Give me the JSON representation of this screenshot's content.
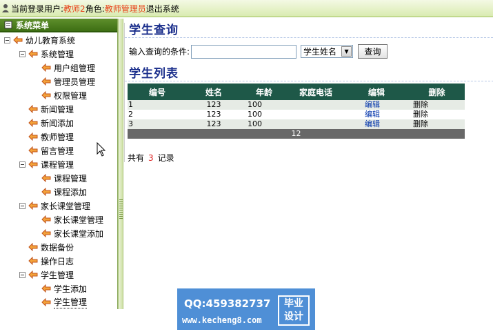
{
  "topbar": {
    "prefix": "当前登录用户:",
    "user": "教师2",
    "role_label": " 角色:",
    "role": "教师管理员",
    "logout": "退出系统"
  },
  "sidebar": {
    "header": "系统菜单",
    "tree": [
      {
        "label": "幼儿教育系统",
        "level": 0,
        "expander": true
      },
      {
        "label": "系统管理",
        "level": 1,
        "expander": true
      },
      {
        "label": "用户组管理",
        "level": 2
      },
      {
        "label": "管理员管理",
        "level": 2
      },
      {
        "label": "权限管理",
        "level": 2
      },
      {
        "label": "新闻管理",
        "level": 1
      },
      {
        "label": "新闻添加",
        "level": 1
      },
      {
        "label": "教师管理",
        "level": 1
      },
      {
        "label": "留言管理",
        "level": 1
      },
      {
        "label": "课程管理",
        "level": 1,
        "expander": true
      },
      {
        "label": "课程管理",
        "level": 2
      },
      {
        "label": "课程添加",
        "level": 2
      },
      {
        "label": "家长课堂管理",
        "level": 1,
        "expander": true
      },
      {
        "label": "家长课堂管理",
        "level": 2
      },
      {
        "label": "家长课堂添加",
        "level": 2
      },
      {
        "label": "数据备份",
        "level": 1
      },
      {
        "label": "操作日志",
        "level": 1
      },
      {
        "label": "学生管理",
        "level": 1,
        "expander": true
      },
      {
        "label": "学生添加",
        "level": 2
      },
      {
        "label": "学生管理",
        "level": 2,
        "selected": true
      }
    ]
  },
  "query": {
    "title": "学生查询",
    "label": "输入查询的条件:",
    "input_value": "",
    "select_value": "学生姓名",
    "button": "查询"
  },
  "list": {
    "title": "学生列表",
    "columns": [
      "编号",
      "姓名",
      "年龄",
      "家庭电话",
      "编辑",
      "删除"
    ],
    "rows": [
      [
        "1",
        "123",
        "100",
        "",
        "编辑",
        "删除"
      ],
      [
        "2",
        "123",
        "100",
        "",
        "编辑",
        "删除"
      ],
      [
        "3",
        "123",
        "100",
        "",
        "编辑",
        "删除"
      ]
    ],
    "pager": "12",
    "count_prefix": "共有",
    "count": "3",
    "count_suffix": "记录"
  },
  "watermark": {
    "qq": "QQ:459382737",
    "url": "www.kecheng8.com",
    "badge_line1": "毕业",
    "badge_line2": "设计"
  },
  "colors": {
    "sidebar_header": "#4a7b1f",
    "section_title": "#1b2f8c",
    "table_header": "#1e5848",
    "highlight_red": "#e8421a",
    "watermark_blue": "#4f8fd6"
  }
}
